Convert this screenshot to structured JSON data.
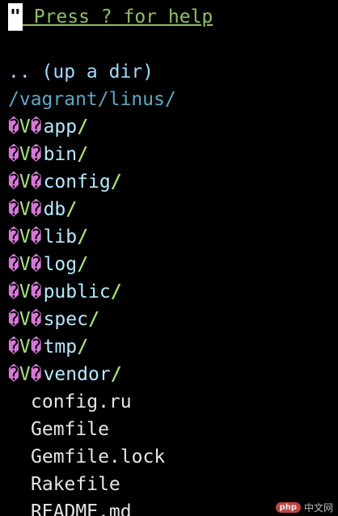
{
  "help_bar": {
    "quote": "\"",
    "text": " Press ? for help"
  },
  "tree": {
    "up_dir": ".. (up a dir)",
    "cwd": "/vagrant/linus/",
    "dir_marker_left": "�",
    "dir_marker_mid": "V",
    "dir_marker_right": "�",
    "dir_slash": "/",
    "directories": [
      "app",
      "bin",
      "config",
      "db",
      "lib",
      "log",
      "public",
      "spec",
      "tmp",
      "vendor"
    ],
    "files": [
      "config.ru",
      "Gemfile",
      "Gemfile.lock",
      "Rakefile",
      "README.md"
    ]
  },
  "watermark": {
    "badge": "php",
    "text": "中文网"
  },
  "colors": {
    "background": "#000000",
    "help_text": "#8fbf60",
    "directory": "#b5e9ff",
    "file": "#e6e6e6",
    "marker": "#d678d6",
    "cwd": "#5fa7c9"
  }
}
